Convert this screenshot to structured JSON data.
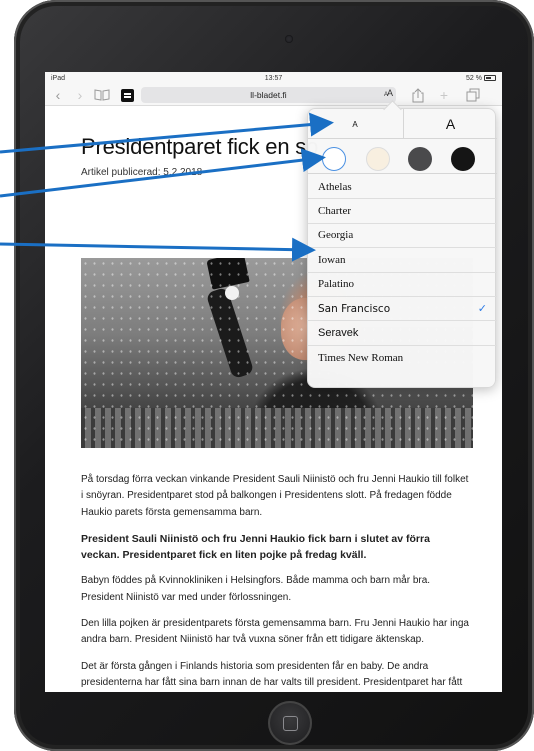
{
  "status_bar": {
    "device": "iPad",
    "time": "13:57",
    "battery": "52 %"
  },
  "toolbar": {
    "url": "ll-bladet.fi",
    "text_size_button": "AA",
    "icons": [
      "chevron-left-icon",
      "chevron-right-icon",
      "book-icon",
      "reader-icon",
      "share-icon",
      "plus-icon",
      "tabs-icon"
    ]
  },
  "article": {
    "title": "Presidentparet fick en so",
    "meta": "Artikel publicerad: 5.2.2018",
    "paragraphs": [
      {
        "text": "På torsdag förra veckan vinkande President Sauli Niinistö och fru Jenni Haukio till folket i snöyran. Presidentparet stod på balkongen i Presidentens slott. På fredagen födde Haukio parets första gemensamma barn.",
        "bold": false
      },
      {
        "text": "President Sauli Niinistö och fru Jenni Haukio fick barn i slutet av förra veckan. Presidentparet fick en liten pojke på fredag kväll.",
        "bold": true
      },
      {
        "text": "Babyn föddes på Kvinnokliniken i Helsingfors. Både mamma och barn mår bra. President Niinistö var med under förlossningen.",
        "bold": false
      },
      {
        "text": "Den lilla pojken är presidentparets första gemensamma barn. Fru Jenni Haukio har inga andra barn. President Niinistö har två vuxna söner från ett tidigare äktenskap.",
        "bold": false
      },
      {
        "text": "Det är första gången i Finlands historia som presidenten får en baby. De andra presidenterna har fått sina barn innan de har valts till president. Presidentparet har fått väldigt många gratulationer.",
        "bold": false
      }
    ]
  },
  "reader_settings": {
    "smaller_label": "A",
    "larger_label": "A",
    "themes": [
      {
        "name": "white",
        "color": "#ffffff",
        "selected": true
      },
      {
        "name": "sepia",
        "color": "#f8efe0",
        "selected": false
      },
      {
        "name": "gray",
        "color": "#4a4a4c",
        "selected": false
      },
      {
        "name": "black",
        "color": "#151515",
        "selected": false
      }
    ],
    "fonts": [
      "Athelas",
      "Charter",
      "Georgia",
      "Iowan",
      "Palatino",
      "San Francisco",
      "Seravek",
      "Times New Roman"
    ],
    "selected_font": "San Francisco",
    "check_mark": "✓"
  },
  "annotation_color": "#1a6fc4"
}
